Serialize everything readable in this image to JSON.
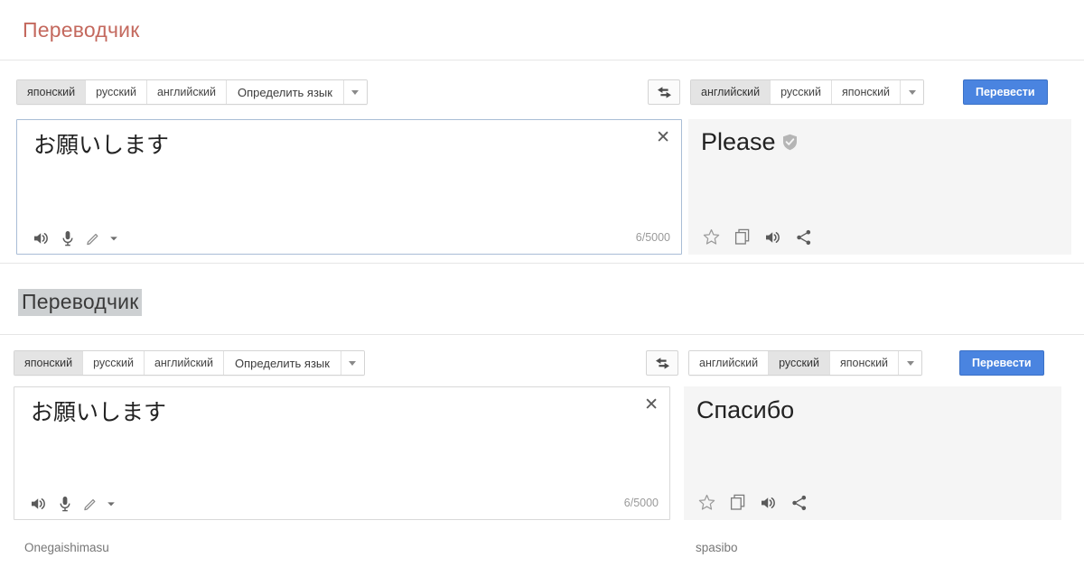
{
  "app": {
    "title_top": "Переводчик",
    "title_bottom": "Переводчик"
  },
  "colors": {
    "title_red": "#c4695e",
    "translate_button": "#4a84e0",
    "selected_pill": "#e4e4e4",
    "output_bg": "#f5f5f5",
    "highlight_bg": "#cdd0d2"
  },
  "panel_top": {
    "source_langs": [
      {
        "label": "японский",
        "selected": true
      },
      {
        "label": "русский",
        "selected": false
      },
      {
        "label": "английский",
        "selected": false
      },
      {
        "label": "Определить язык",
        "selected": false
      }
    ],
    "source_caret": "chevron-down-icon",
    "swap_icon": "swap-horizontal-icon",
    "target_langs": [
      {
        "label": "английский",
        "selected": true
      },
      {
        "label": "русский",
        "selected": false
      },
      {
        "label": "японский",
        "selected": false
      }
    ],
    "target_caret": "chevron-down-icon",
    "translate_label": "Перевести",
    "source_text": "お願いします",
    "clear_label": "✕",
    "counter": "6/5000",
    "source_tools": [
      "speaker-icon",
      "microphone-icon",
      "pencil-icon",
      "chevron-down-icon"
    ],
    "output_text": "Please",
    "output_badge": "verified-shield-icon",
    "output_tools": [
      "star-icon",
      "copy-icon",
      "speaker-icon",
      "share-icon"
    ]
  },
  "panel_bottom": {
    "source_langs": [
      {
        "label": "японский",
        "selected": true
      },
      {
        "label": "русский",
        "selected": false
      },
      {
        "label": "английский",
        "selected": false
      },
      {
        "label": "Определить язык",
        "selected": false
      }
    ],
    "source_caret": "chevron-down-icon",
    "swap_icon": "swap-horizontal-icon",
    "target_langs": [
      {
        "label": "английский",
        "selected": false
      },
      {
        "label": "русский",
        "selected": true
      },
      {
        "label": "японский",
        "selected": false
      }
    ],
    "target_caret": "chevron-down-icon",
    "translate_label": "Перевести",
    "source_text": "お願いします",
    "clear_label": "✕",
    "counter": "6/5000",
    "source_tools": [
      "speaker-icon",
      "microphone-icon",
      "pencil-icon",
      "chevron-down-icon"
    ],
    "output_text": "Спасибо",
    "output_tools": [
      "star-icon",
      "copy-icon",
      "speaker-icon",
      "share-icon"
    ],
    "source_translit": "Onegaishimasu",
    "output_translit": "spasibo"
  }
}
